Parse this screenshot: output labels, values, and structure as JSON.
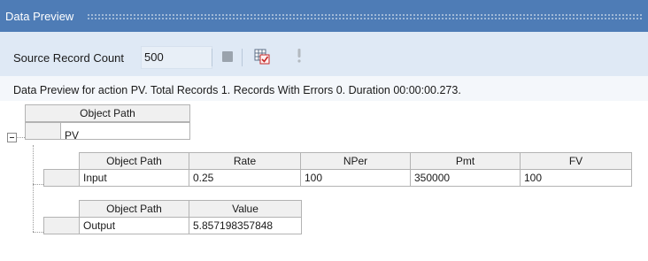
{
  "panel": {
    "title": "Data Preview"
  },
  "toolbar": {
    "source_label": "Source Record Count",
    "source_value": "500",
    "stop_icon": "stop-icon",
    "grid_icon": "grid-check-icon",
    "info_icon": "exclamation-icon"
  },
  "status": {
    "text": "Data Preview for action PV. Total Records 1. Records With Errors 0. Duration 00:00:00.273."
  },
  "master": {
    "header": "Object Path",
    "row": "PV"
  },
  "input_grid": {
    "headers": [
      "Object Path",
      "Rate",
      "NPer",
      "Pmt",
      "FV"
    ],
    "row": [
      "Input",
      "0.25",
      "100",
      "350000",
      "100"
    ]
  },
  "output_grid": {
    "headers": [
      "Object Path",
      "Value"
    ],
    "row": [
      "Output",
      "5.857198357848"
    ]
  }
}
